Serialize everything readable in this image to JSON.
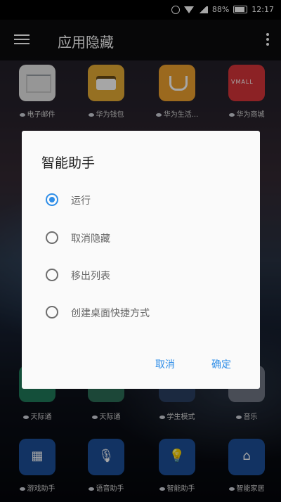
{
  "status_bar": {
    "battery": "88%",
    "time": "12:17",
    "icons": [
      "alarm-icon",
      "wifi-icon",
      "signal-icon",
      "battery-icon"
    ]
  },
  "app_bar": {
    "title": "应用隐藏",
    "menu_icon": "hamburger-menu-icon",
    "more_icon": "more-vertical-icon"
  },
  "apps_row1": [
    {
      "label": "电子邮件",
      "icon": "email-icon",
      "color": "#e6e6e6"
    },
    {
      "label": "华为钱包",
      "icon": "wallet-icon",
      "color": "#e7ad35"
    },
    {
      "label": "华为生活...",
      "icon": "coffee-icon",
      "color": "#efa22e"
    },
    {
      "label": "华为商城",
      "icon": "vmall-icon",
      "color": "#d8353a"
    }
  ],
  "apps_row_lower": [
    {
      "label": "天际通",
      "icon": "globe-icon"
    },
    {
      "label": "天际通",
      "icon": "globe-icon"
    },
    {
      "label": "学生模式",
      "icon": "student-icon"
    },
    {
      "label": "音乐",
      "icon": "music-icon"
    }
  ],
  "apps_bottom": [
    {
      "label": "游戏助手",
      "icon": "game-assistant-icon"
    },
    {
      "label": "语音助手",
      "icon": "microphone-icon"
    },
    {
      "label": "智能助手",
      "icon": "lightbulb-icon"
    },
    {
      "label": "智能家居",
      "icon": "smart-home-icon"
    }
  ],
  "dialog": {
    "title": "智能助手",
    "options": [
      {
        "label": "运行",
        "selected": true
      },
      {
        "label": "取消隐藏",
        "selected": false
      },
      {
        "label": "移出列表",
        "selected": false
      },
      {
        "label": "创建桌面快捷方式",
        "selected": false
      }
    ],
    "cancel_label": "取消",
    "ok_label": "确定",
    "accent_color": "#2f8ee8"
  }
}
